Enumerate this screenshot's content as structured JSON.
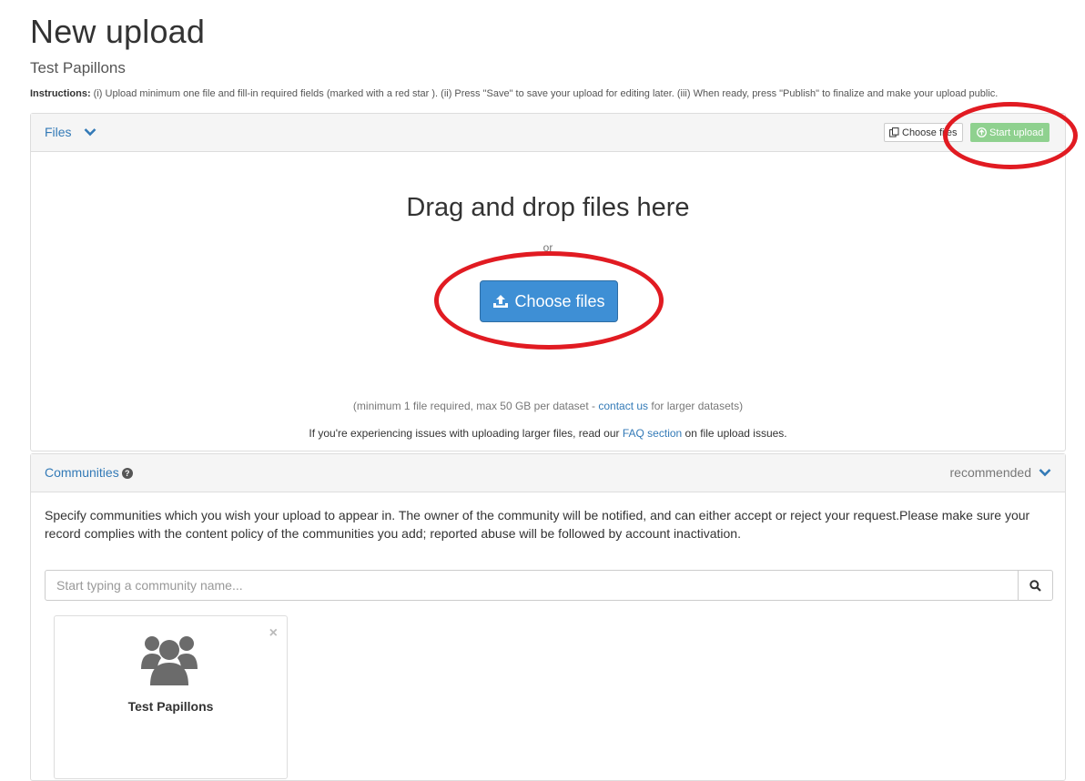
{
  "header": {
    "title": "New upload",
    "subtitle": "Test Papillons",
    "instructions_label": "Instructions:",
    "instructions_text": " (i) Upload minimum one file and fill-in required fields (marked with a red star ). (ii) Press \"Save\" to save your upload for editing later. (iii) When ready, press \"Publish\" to finalize and make your upload public."
  },
  "files": {
    "heading": "Files",
    "choose_small": "Choose files",
    "start_upload": "Start upload",
    "drop_title": "Drag and drop files here",
    "or": "or",
    "choose_big": "Choose files",
    "min_prefix": "(minimum 1 file required, max 50 GB per dataset - ",
    "contact_link": "contact us",
    "min_suffix": " for larger datasets)",
    "faq_prefix": "If you're experiencing issues with uploading larger files, read our ",
    "faq_link": "FAQ section",
    "faq_suffix": " on file upload issues."
  },
  "communities": {
    "heading": "Communities",
    "recommended": "recommended",
    "description": "Specify communities which you wish your upload to appear in. The owner of the community will be notified, and can either accept or reject your request.Please make sure your record complies with the content policy of the communities you add; reported abuse will be followed by account inactivation.",
    "search_placeholder": "Start typing a community name...",
    "card_name": "Test Papillons"
  },
  "colors": {
    "primary": "#3e8fd5",
    "success_light": "#8fd18f",
    "link": "#337ab7",
    "annotation": "#e11b22"
  },
  "icons": [
    "chevron-down-icon",
    "copy-icon",
    "circle-arrow-up-icon",
    "upload-icon",
    "question-circle-icon",
    "search-icon",
    "users-icon",
    "close-icon"
  ]
}
